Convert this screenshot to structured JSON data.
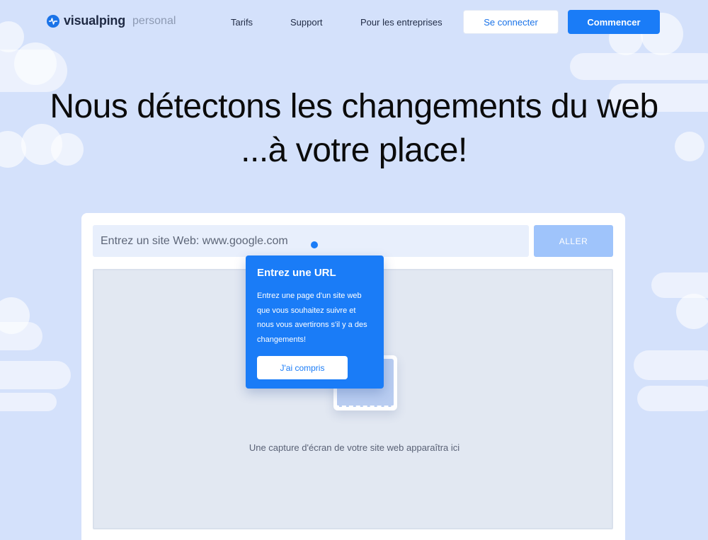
{
  "brand": {
    "name": "visualping",
    "plan": "personal"
  },
  "nav": {
    "links": [
      "Tarifs",
      "Support",
      "Pour les entreprises"
    ],
    "login": "Se connecter",
    "start": "Commencer"
  },
  "hero": {
    "line1": "Nous détectons les changements du web",
    "line2": "...à votre place!"
  },
  "search": {
    "placeholder": "Entrez un site Web: www.google.com",
    "go": "ALLER"
  },
  "preview": {
    "caption": "Une capture d'écran de votre site web apparaîtra ici"
  },
  "tooltip": {
    "title": "Entrez une URL",
    "body": "Entrez une page d'un site web que vous souhaitez suivre et nous vous avertirons s'il y a des changements!",
    "button": "J'ai compris"
  },
  "colors": {
    "accent": "#1a7cf7",
    "background": "#d4e1fb"
  },
  "icons": [
    "pulse-logo-icon",
    "screenshot-placeholder-icon",
    "tooltip-beacon-icon"
  ]
}
